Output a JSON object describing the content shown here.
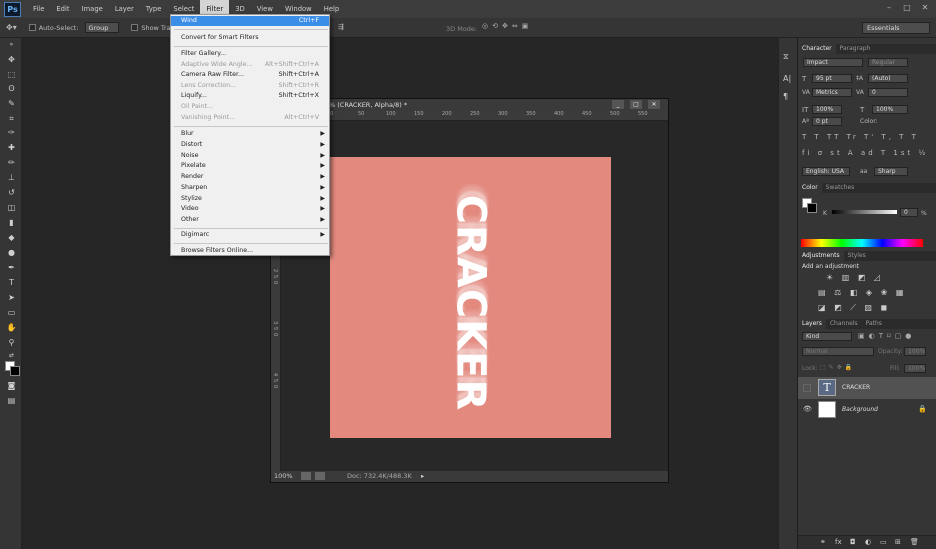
{
  "app": {
    "logo": "Ps"
  },
  "menubar": {
    "items": [
      "File",
      "Edit",
      "Image",
      "Layer",
      "Type",
      "Select",
      "Filter",
      "3D",
      "View",
      "Window",
      "Help"
    ],
    "active": "Filter"
  },
  "options": {
    "tool_icon": "move-tool-icon",
    "auto_select_label": "Auto-Select:",
    "auto_select_value": "Group",
    "show_transform_label": "Show Tran",
    "mode_3d": "3D Mode:",
    "workspace": "Essentials"
  },
  "filter_menu": {
    "items": [
      {
        "label": "Wind",
        "shortcut": "Ctrl+F",
        "state": "highlight"
      },
      {
        "label": "Convert for Smart Filters",
        "shortcut": "",
        "state": "normal"
      },
      {
        "label": "Filter Gallery...",
        "shortcut": "",
        "state": "normal"
      },
      {
        "label": "Adaptive Wide Angle...",
        "shortcut": "Alt+Shift+Ctrl+A",
        "state": "disabled"
      },
      {
        "label": "Camera Raw Filter...",
        "shortcut": "Shift+Ctrl+A",
        "state": "normal"
      },
      {
        "label": "Lens Correction...",
        "shortcut": "Shift+Ctrl+R",
        "state": "disabled"
      },
      {
        "label": "Liquify...",
        "shortcut": "Shift+Ctrl+X",
        "state": "normal"
      },
      {
        "label": "Oil Paint...",
        "shortcut": "",
        "state": "disabled"
      },
      {
        "label": "Vanishing Point...",
        "shortcut": "Alt+Ctrl+V",
        "state": "disabled"
      },
      {
        "label": "Blur",
        "shortcut": "",
        "state": "submenu"
      },
      {
        "label": "Distort",
        "shortcut": "",
        "state": "submenu"
      },
      {
        "label": "Noise",
        "shortcut": "",
        "state": "submenu"
      },
      {
        "label": "Pixelate",
        "shortcut": "",
        "state": "submenu"
      },
      {
        "label": "Render",
        "shortcut": "",
        "state": "submenu"
      },
      {
        "label": "Sharpen",
        "shortcut": "",
        "state": "submenu"
      },
      {
        "label": "Stylize",
        "shortcut": "",
        "state": "submenu"
      },
      {
        "label": "Video",
        "shortcut": "",
        "state": "submenu"
      },
      {
        "label": "Other",
        "shortcut": "",
        "state": "submenu"
      },
      {
        "label": "Digimarc",
        "shortcut": "",
        "state": "submenu"
      },
      {
        "label": "Browse Filters Online...",
        "shortcut": "",
        "state": "normal"
      }
    ]
  },
  "document": {
    "title": "% (CRACKER, Alpha/8) *",
    "ruler_top": [
      "0",
      "50",
      "100",
      "150",
      "200",
      "250",
      "300",
      "350",
      "400",
      "450",
      "500",
      "550"
    ],
    "ruler_left": [
      "1",
      "5",
      "0",
      "1",
      "5",
      "0",
      "2",
      "5",
      "0",
      "3",
      "5",
      "0",
      "4",
      "5",
      "0"
    ],
    "canvas_text": "CRACKER",
    "canvas_color": "#e3897e",
    "zoom": "100%",
    "doc_info": "Doc: 732.4K/488.3K"
  },
  "character_panel": {
    "tabs": [
      "Character",
      "Paragraph"
    ],
    "font_family": "Impact",
    "font_style": "Regular",
    "font_size": "95 pt",
    "leading": "(Auto)",
    "kerning": "Metrics",
    "tracking": "0",
    "vscale": "100%",
    "hscale": "100%",
    "baseline": "0 pt",
    "color_label": "Color:",
    "style_buttons": "T T TT Tr T' T, T T",
    "ot_buttons": "fi σ st A ad T 1st ½",
    "language": "English: USA",
    "aa_label": "aa",
    "antialias": "Sharp"
  },
  "color_panel": {
    "tabs": [
      "Color",
      "Swatches"
    ],
    "channel": "K",
    "value": "0",
    "unit": "%"
  },
  "adjustments_panel": {
    "tabs": [
      "Adjustments",
      "Styles"
    ],
    "heading": "Add an adjustment",
    "row1": "☀ ▥ ◩ ◿",
    "row2": "▤ ⚖ ◧ ◈ ❀ ▦",
    "row3": "◪ ◩ ⟋ ▨ ◼"
  },
  "layers_panel": {
    "tabs": [
      "Layers",
      "Channels",
      "Paths"
    ],
    "filter_kind": "Kind",
    "blend_mode": "Normal",
    "opacity_label": "Opacity:",
    "opacity": "100%",
    "lock_label": "Lock:",
    "fill_label": "Fill:",
    "fill": "100%",
    "layers": [
      {
        "name": "CRACKER",
        "type": "text",
        "visible": false,
        "selected": true
      },
      {
        "name": "Background",
        "type": "image",
        "visible": true,
        "locked": true
      }
    ]
  }
}
